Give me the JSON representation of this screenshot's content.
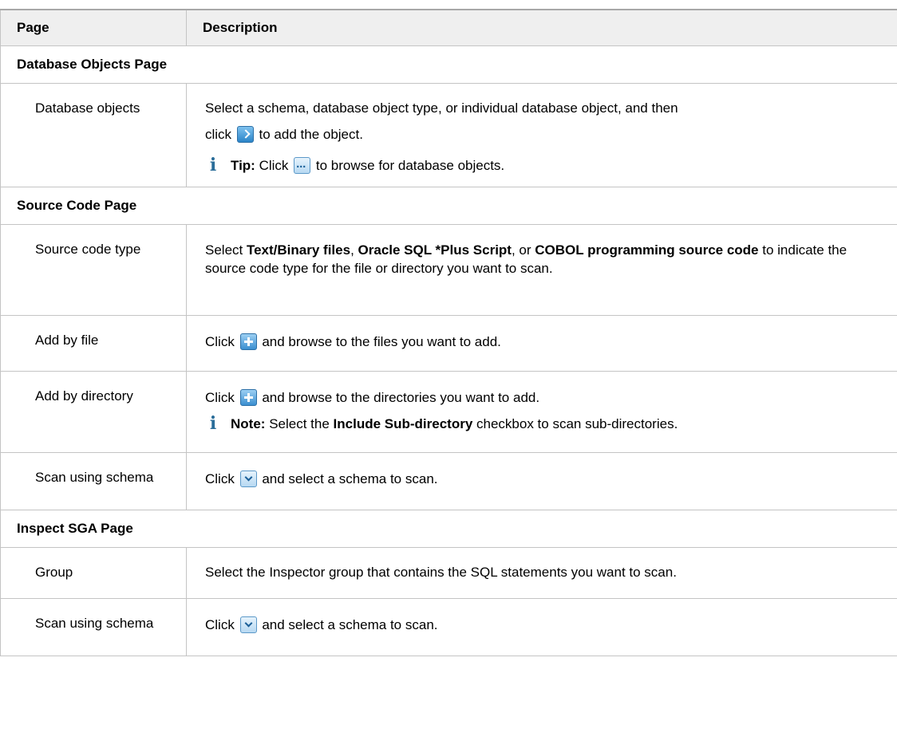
{
  "table": {
    "header": {
      "col1": "Page",
      "col2": "Description"
    },
    "sections": [
      {
        "title": "Database Objects Page",
        "rows": [
          {
            "name": "Database objects",
            "line1": "Select a schema, database object type, or individual database object, and then",
            "line2_pre": "click",
            "line2_icon": "arrow-right-icon",
            "line2_post": "to add the object.",
            "tip_label": "Tip:",
            "tip_pre": "Click",
            "tip_icon": "browse-ellipsis-icon",
            "tip_post": "to browse for database objects."
          }
        ]
      },
      {
        "title": "Source Code Page",
        "rows": [
          {
            "name": "Source code type",
            "text_pre": "Select",
            "opt1": "Text/Binary files",
            "sep1": ",",
            "opt2": "Oracle SQL *Plus Script",
            "sep2": ", or",
            "opt3": "COBOL programming source code",
            "text_post": "to indicate the source code type for the file or directory you want to scan."
          },
          {
            "name": "Add by file",
            "pre": "Click",
            "icon": "add-plus-icon",
            "post": "and browse to the files you want to add."
          },
          {
            "name": "Add by directory",
            "pre": "Click",
            "icon": "add-plus-icon",
            "post": "and browse to the directories you want to add.",
            "note_label": "Note:",
            "note_pre": "Select the",
            "note_bold": "Include Sub-directory",
            "note_post": "checkbox to scan sub-directories."
          },
          {
            "name": "Scan using schema",
            "pre": "Click",
            "icon": "dropdown-icon",
            "post": "and select a schema to scan."
          }
        ]
      },
      {
        "title": "Inspect SGA Page",
        "rows": [
          {
            "name": "Group",
            "text": "Select the Inspector group that contains the SQL statements you want to scan."
          },
          {
            "name": "Scan using schema",
            "pre": "Click",
            "icon": "dropdown-icon",
            "post": "and select a schema to scan."
          }
        ]
      }
    ]
  }
}
